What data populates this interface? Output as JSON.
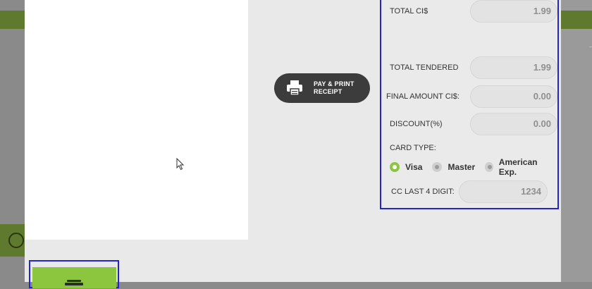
{
  "pay_button": {
    "line1": "PAY & PRINT",
    "line2": "RECEIPT"
  },
  "totals": {
    "total_label": "TOTAL CI$",
    "total_value": "1.99",
    "tendered_label": "TOTAL TENDERED",
    "tendered_value": "1.99",
    "final_label": "FINAL AMOUNT CI$:",
    "final_value": "0.00",
    "discount_label": "DISCOUNT(%)",
    "discount_value": "0.00"
  },
  "card": {
    "type_label": "CARD TYPE:",
    "options": [
      {
        "label": "Visa",
        "selected": true
      },
      {
        "label": "Master",
        "selected": false
      },
      {
        "label": "American Exp.",
        "selected": false
      }
    ],
    "last4_label": "CC LAST 4 DIGIT:",
    "last4_value": "1234"
  },
  "icons": {
    "printer": "printer-icon",
    "cash": "cash-icon",
    "timer": "timer-icon"
  },
  "colors": {
    "accent": "#8cc63f",
    "highlight_border": "#2323d6",
    "button_dark": "#3c3c3c",
    "header_green": "#5f7a2e"
  }
}
